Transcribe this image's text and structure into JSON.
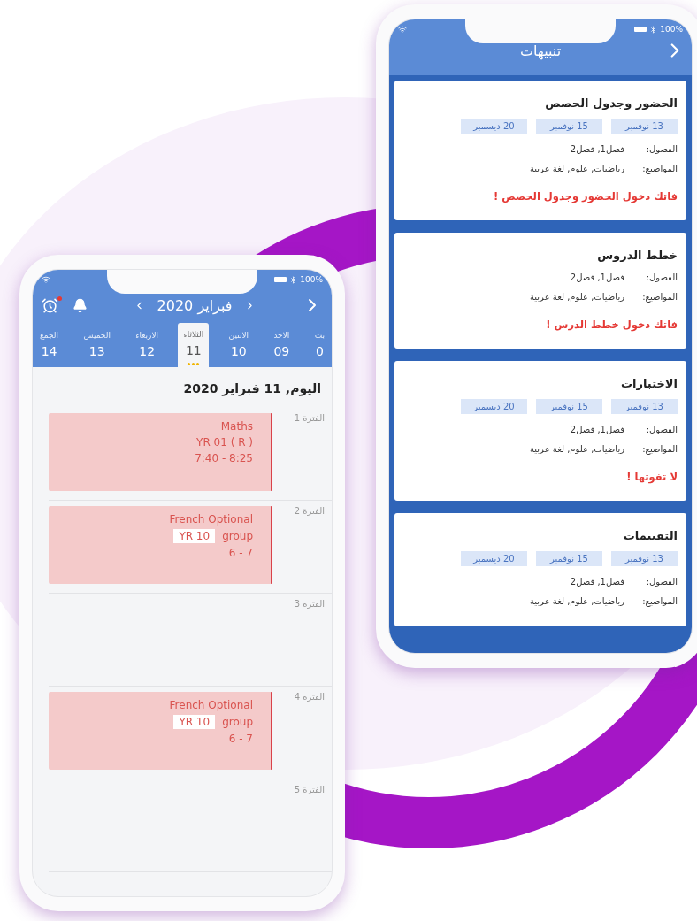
{
  "schedule_phone": {
    "battery": "100%",
    "month": "فبراير 2020",
    "days": [
      {
        "name": "بت",
        "date": "0",
        "selected": false
      },
      {
        "name": "الاحد",
        "date": "09",
        "selected": false
      },
      {
        "name": "الاثنين",
        "date": "10",
        "selected": false
      },
      {
        "name": "الثلاثاء",
        "date": "11",
        "selected": true
      },
      {
        "name": "الاربعاء",
        "date": "12",
        "selected": false
      },
      {
        "name": "الخميس",
        "date": "13",
        "selected": false
      },
      {
        "name": "الجمع",
        "date": "14",
        "selected": false
      }
    ],
    "today": "اليوم, 11 فبراير 2020",
    "periods": [
      {
        "label": "الفترة 1",
        "lesson": {
          "title": "Maths",
          "class": "YR 01 ( R )",
          "time": "7:40 - 8:25"
        }
      },
      {
        "label": "الفترة 2",
        "lesson": {
          "title": "French Optional",
          "tag": "YR 10",
          "class": "group",
          "time": "6 - 7"
        }
      },
      {
        "label": "الفترة 3"
      },
      {
        "label": "الفترة 4",
        "lesson": {
          "title": "French Optional",
          "tag": "YR 10",
          "class": "group",
          "time": "6 - 7"
        }
      },
      {
        "label": "الفترة 5"
      }
    ]
  },
  "alerts_phone": {
    "battery": "100%",
    "title": "تنبيهات",
    "cards": [
      {
        "title": "الحضور وجدول الحصص",
        "dates": [
          "13 نوفمبر",
          "15 نوفمبر",
          "20 ديسمبر"
        ],
        "rows": [
          {
            "label": "الفصول:",
            "value": "فصل1, فصل2"
          },
          {
            "label": "المواضيع:",
            "value": "رياضيات, علوم, لغة عربية"
          }
        ],
        "warning": "فاتك دخول الحضور وجدول الحصص !"
      },
      {
        "title": "خطط الدروس",
        "rows": [
          {
            "label": "الفصول:",
            "value": "فصل1, فصل2"
          },
          {
            "label": "المواضيع:",
            "value": "رياضيات, علوم, لغة عربية"
          }
        ],
        "warning": "فاتك دخول خطط الدرس !"
      },
      {
        "title": "الاختبارات",
        "dates": [
          "13 نوفمبر",
          "15 نوفمبر",
          "20 ديسمبر"
        ],
        "rows": [
          {
            "label": "الفصول:",
            "value": "فصل1, فصل2"
          },
          {
            "label": "المواضيع:",
            "value": "رياضيات, علوم, لغة عربية"
          }
        ],
        "warning": "لا تفوتها !"
      },
      {
        "title": "التقييمات",
        "dates": [
          "13 نوفمبر",
          "15 نوفمبر",
          "20 ديسمبر"
        ],
        "rows": [
          {
            "label": "الفصول:",
            "value": "فصل1, فصل2"
          },
          {
            "label": "المواضيع:",
            "value": "رياضيات, علوم, لغة عربية"
          }
        ]
      }
    ]
  }
}
